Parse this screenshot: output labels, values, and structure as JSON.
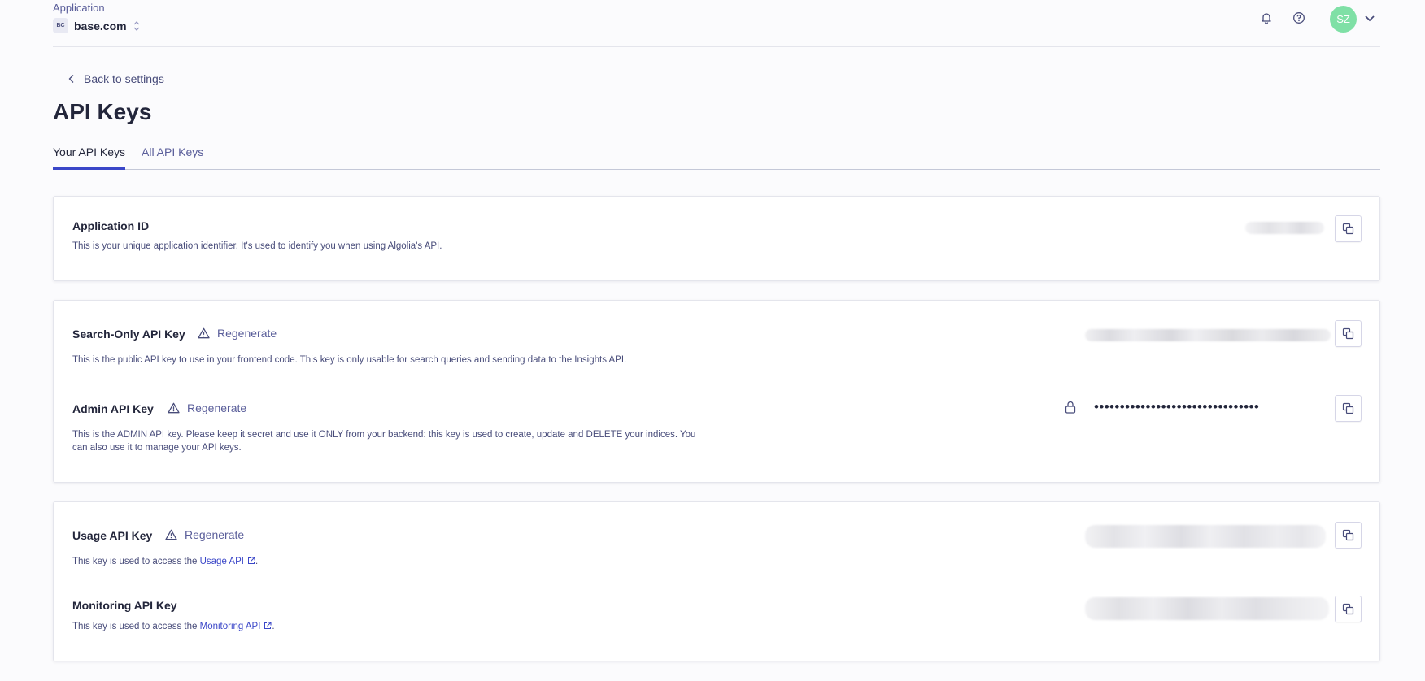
{
  "header": {
    "app_label": "Application",
    "app_badge": "BC",
    "app_name": "base.com",
    "avatar_initials": "SZ",
    "icons": [
      "bell-icon",
      "help-icon",
      "chevron-down-icon",
      "sort-icon"
    ],
    "colors": {
      "avatar": "#7fe0a6",
      "accent": "#3a46c8"
    }
  },
  "nav": {
    "back_label": "Back to settings"
  },
  "page": {
    "title": "API Keys"
  },
  "tabs": [
    {
      "label": "Your API Keys",
      "active": true
    },
    {
      "label": "All API Keys",
      "active": false
    }
  ],
  "cards": {
    "application_id": {
      "title": "Application ID",
      "description": "This is your unique application identifier. It's used to identify you when using Algolia's API."
    },
    "search_key": {
      "title": "Search-Only API Key",
      "regenerate": "Regenerate",
      "description": "This is the public API key to use in your frontend code. This key is only usable for search queries and sending data to the Insights API."
    },
    "admin_key": {
      "title": "Admin API Key",
      "regenerate": "Regenerate",
      "masked_value": "••••••••••••••••••••••••••••••••",
      "description_line1": "This is the ADMIN API key. Please keep it secret and use it ONLY from your backend: this key is used to create, update and DELETE your indices. You",
      "description_line2": "can also use it to manage your API keys."
    },
    "usage_key": {
      "title": "Usage API Key",
      "regenerate": "Regenerate",
      "desc_prefix": "This key is used to access the ",
      "link": "Usage API",
      "desc_suffix": "."
    },
    "monitoring_key": {
      "title": "Monitoring API Key",
      "desc_prefix": "This key is used to access the ",
      "link": "Monitoring API",
      "desc_suffix": "."
    }
  }
}
